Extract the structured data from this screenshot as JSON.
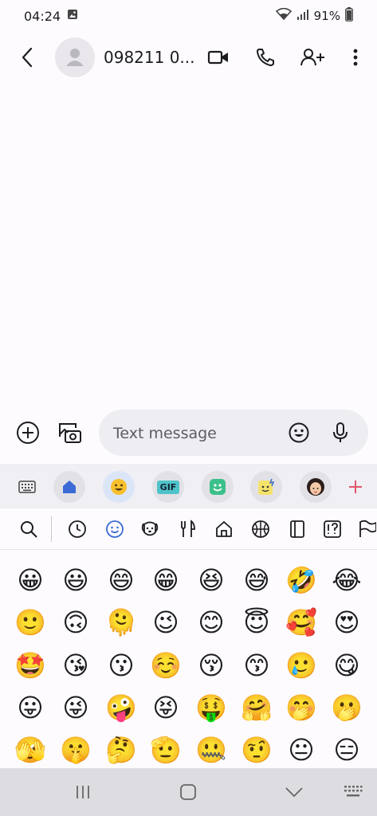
{
  "status": {
    "time": "04:24",
    "battery": "91%"
  },
  "header": {
    "contact_name": "098211 0..."
  },
  "compose": {
    "placeholder": "Text message"
  },
  "keyboard": {
    "gif_label": "GIF",
    "emojis": [
      [
        "😀",
        "😃",
        "😄",
        "😁",
        "😆",
        "😅",
        "🤣",
        "😂"
      ],
      [
        "🙂",
        "🙃",
        "🫠",
        "😉",
        "😊",
        "😇",
        "🥰",
        "😍"
      ],
      [
        "🤩",
        "😘",
        "😗",
        "☺️",
        "😚",
        "😙",
        "🥲",
        "😋"
      ],
      [
        "😛",
        "😜",
        "🤪",
        "😝",
        "🤑",
        "🤗",
        "🤭",
        "🫢"
      ],
      [
        "🫣",
        "🤫",
        "🤔",
        "🫡",
        "🤐",
        "🤨",
        "😐",
        "😑"
      ]
    ]
  },
  "colors": {
    "accent": "#3b6bd6",
    "emoji_category_active": "#3b6bd6",
    "plus_sticker": "#e0566c"
  }
}
